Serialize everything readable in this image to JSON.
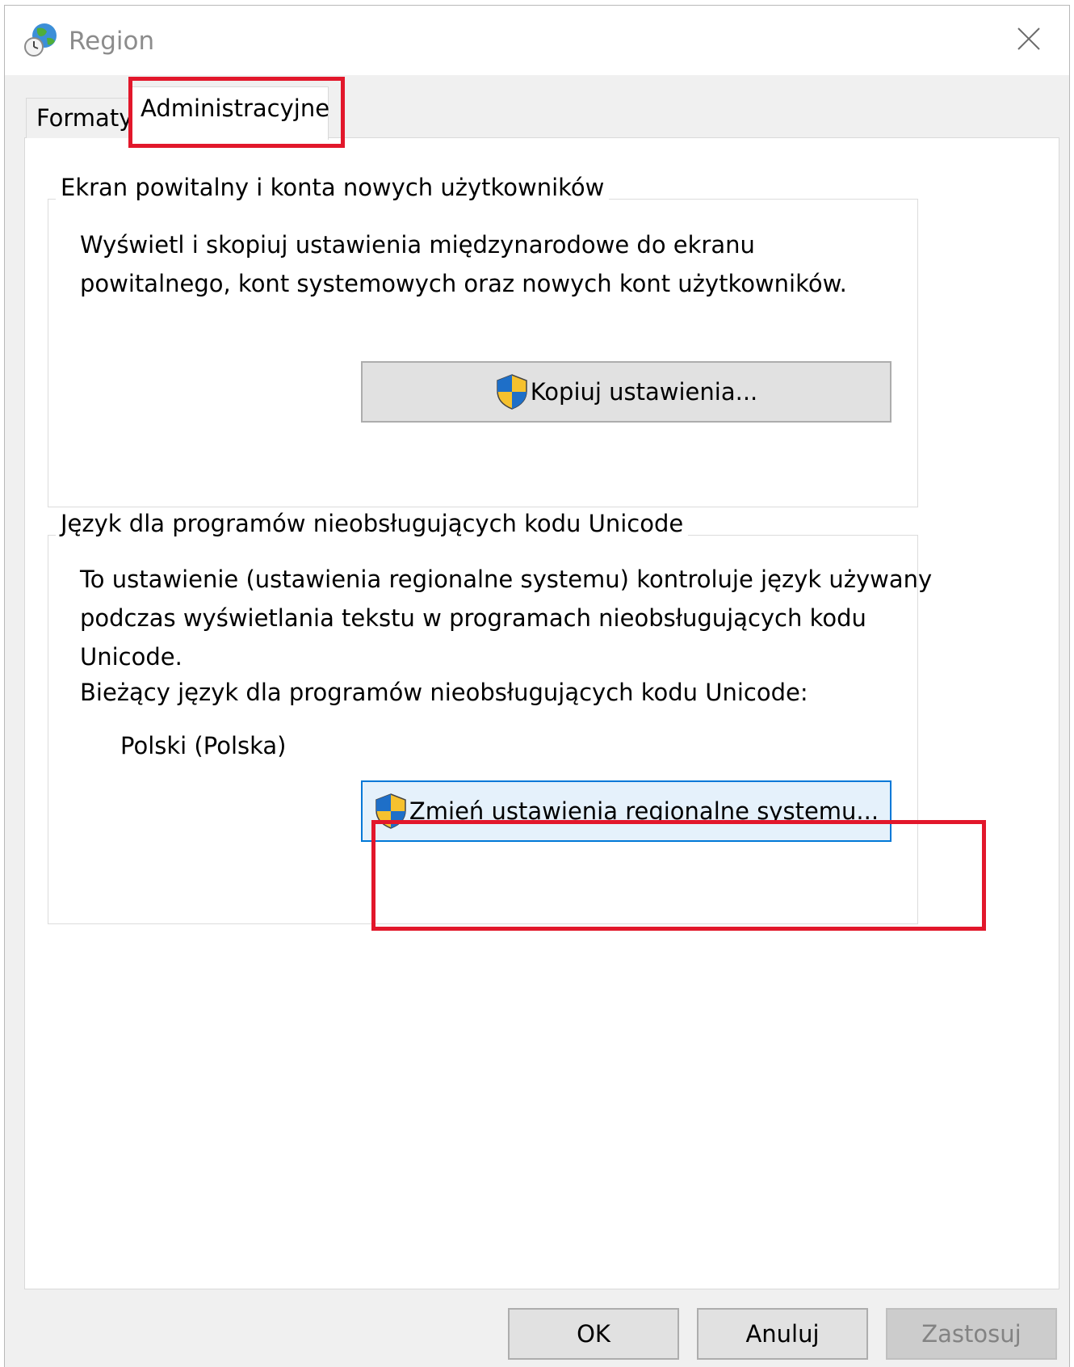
{
  "window": {
    "title": "Region",
    "title_icon": "globe-clock-icon",
    "close_icon": "close-icon"
  },
  "tabs": [
    {
      "label": "Formaty",
      "selected": false
    },
    {
      "label": "Administracyjne",
      "selected": true
    }
  ],
  "welcome_group": {
    "title": "Ekran powitalny i konta nowych użytkowników",
    "description_lines": [
      "Wyświetl i skopiuj ustawienia międzynarodowe do ekranu",
      "powitalnego, kont systemowych oraz nowych kont użytkowników."
    ],
    "copy_button_label": "Kopiuj ustawienia...",
    "button_icon": "uac-shield-icon"
  },
  "unicode_group": {
    "title": "Język dla programów nieobsługujących kodu Unicode",
    "description_lines": [
      "To ustawienie (ustawienia regionalne systemu) kontroluje język używany",
      "podczas wyświetlania tekstu w programach nieobsługujących kodu",
      "Unicode."
    ],
    "current_label": "Bieżący język dla programów nieobsługujących kodu Unicode:",
    "current_value": "Polski (Polska)",
    "change_button_label": "Zmień ustawienia regionalne systemu...",
    "button_icon": "uac-shield-icon"
  },
  "footer": {
    "ok_label": "OK",
    "cancel_label": "Anuluj",
    "apply_label": "Zastosuj",
    "apply_enabled": false
  },
  "colors": {
    "highlight": "#e2172b",
    "focused_button_border": "#0078d7",
    "focused_button_fill": "#e5f1fb",
    "shield_blue": "#1e6fc8",
    "shield_yellow": "#f6c12e"
  }
}
